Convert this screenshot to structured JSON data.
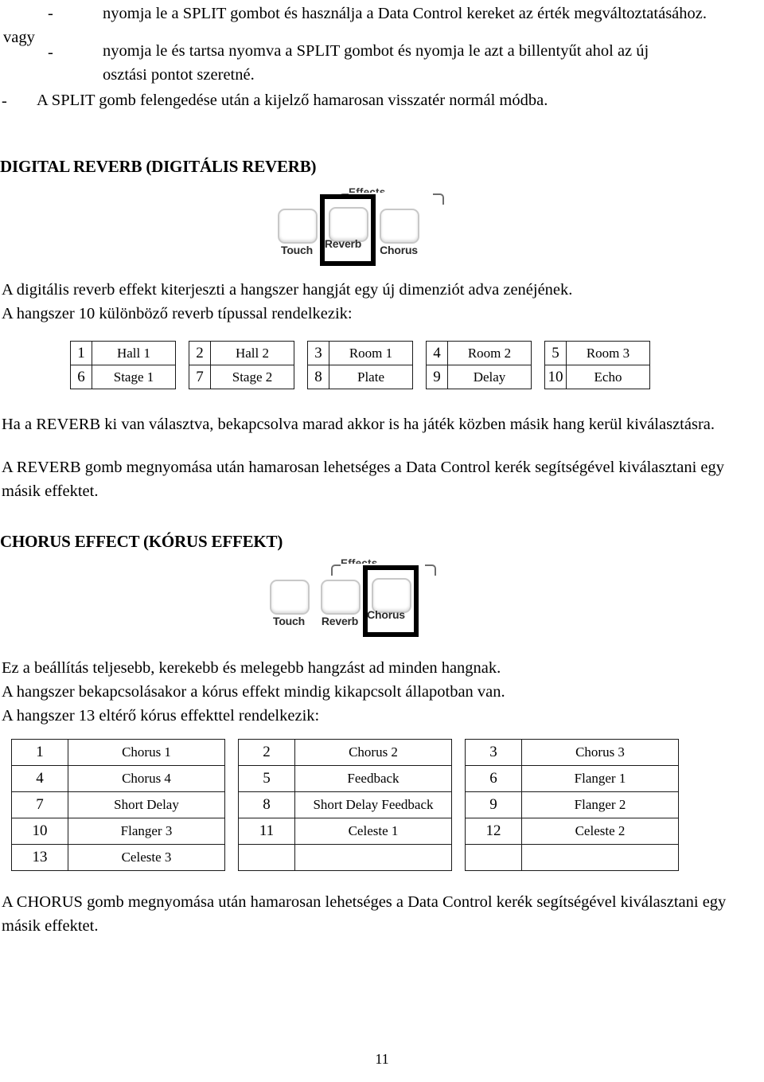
{
  "instructions": {
    "bullet_char": "-",
    "item1": "nyomja le a SPLIT gombot és használja a Data Control kereket az érték megváltoztatásához.",
    "or_label": "vagy",
    "item2_line1": "nyomja le és tartsa nyomva a SPLIT  gombot és nyomja le azt a billentyűt ahol az új",
    "item2_line2": "osztási pontot szeretné.",
    "item3": "A SPLIT gomb felengedése után a kijelző hamarosan visszatér normál módba."
  },
  "reverb_section": {
    "heading": "DIGITAL REVERB (DIGITÁLIS REVERB)",
    "panel": {
      "group_label": "Effects",
      "buttons": [
        {
          "label": "Touch",
          "highlighted": false
        },
        {
          "label": "Reverb",
          "highlighted": true
        },
        {
          "label": "Chorus",
          "highlighted": false
        }
      ]
    },
    "intro": "A digitális reverb effekt kiterjeszti a hangszer hangját egy új dimenziót adva zenéjének.\nA hangszer 10 különböző reverb típussal rendelkezik:",
    "note": "Ha a REVERB ki van választva, bekapcsolva marad akkor is ha játék közben másik hang kerül kiválasztásra.",
    "howto": "A REVERB gomb megnyomása után hamarosan lehetséges a Data Control kerék segítségével kiválasztani egy másik effektet.",
    "table": {
      "rows": [
        [
          {
            "num": "1",
            "label": "Hall 1"
          },
          {
            "num": "2",
            "label": "Hall 2"
          },
          {
            "num": "3",
            "label": "Room 1"
          },
          {
            "num": "4",
            "label": "Room 2"
          },
          {
            "num": "5",
            "label": "Room 3"
          }
        ],
        [
          {
            "num": "6",
            "label": "Stage 1"
          },
          {
            "num": "7",
            "label": "Stage 2"
          },
          {
            "num": "8",
            "label": "Plate"
          },
          {
            "num": "9",
            "label": "Delay"
          },
          {
            "num": "10",
            "label": "Echo"
          }
        ]
      ]
    }
  },
  "chorus_section": {
    "heading": "CHORUS EFFECT (KÓRUS EFFEKT)",
    "panel": {
      "group_label": "Effects",
      "buttons": [
        {
          "label": "Touch",
          "highlighted": false
        },
        {
          "label": "Reverb",
          "highlighted": false
        },
        {
          "label": "Chorus",
          "highlighted": true
        }
      ]
    },
    "intro": "Ez a beállítás teljesebb, kerekebb és melegebb hangzást ad minden hangnak.\nA hangszer bekapcsolásakor a kórus effekt mindig kikapcsolt állapotban van.\nA hangszer 13 eltérő kórus effekttel rendelkezik:",
    "howto": "A CHORUS gomb megnyomása után hamarosan lehetséges a Data Control kerék segítségével kiválasztani egy másik effektet.",
    "table": {
      "rows": [
        [
          {
            "num": "1",
            "label": "Chorus 1"
          },
          {
            "num": "2",
            "label": "Chorus 2"
          },
          {
            "num": "3",
            "label": "Chorus 3"
          }
        ],
        [
          {
            "num": "4",
            "label": "Chorus 4"
          },
          {
            "num": "5",
            "label": "Feedback"
          },
          {
            "num": "6",
            "label": "Flanger 1"
          }
        ],
        [
          {
            "num": "7",
            "label": "Short Delay"
          },
          {
            "num": "8",
            "label": "Short Delay Feedback"
          },
          {
            "num": "9",
            "label": "Flanger 2"
          }
        ],
        [
          {
            "num": "10",
            "label": "Flanger 3"
          },
          {
            "num": "11",
            "label": "Celeste 1"
          },
          {
            "num": "12",
            "label": "Celeste 2"
          }
        ],
        [
          {
            "num": "13",
            "label": "Celeste 3"
          },
          {
            "num": "",
            "label": ""
          },
          {
            "num": "",
            "label": ""
          }
        ]
      ]
    }
  },
  "footer": {
    "page_number": "11"
  }
}
